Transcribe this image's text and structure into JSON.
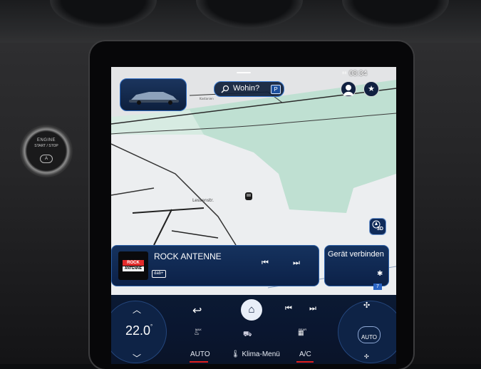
{
  "status": {
    "time": "08:34",
    "signal": "±±"
  },
  "search": {
    "label": "Wohin?",
    "parking_badge": "P"
  },
  "map": {
    "street_label": "Lessenstr.",
    "minor_label": "Kastanien",
    "view_3d_label": "3D"
  },
  "media": {
    "station_name": "ROCK ANTENNE",
    "logo_top": "ROCK",
    "logo_bottom": "ANTENNE",
    "dab_badge": "dab+",
    "prev_icon": "⏮",
    "next_icon": "⏭"
  },
  "connect": {
    "label": "Gerät verbinden",
    "bluetooth_icon": "✱",
    "badge": "7"
  },
  "climate": {
    "temperature": "22.0",
    "temp_unit": "°",
    "fan_mode": "AUTO",
    "auto_label": "AUTO",
    "klima_menu_label": "Klima-Menü",
    "ac_label": "A/C",
    "front_defrost_small": "MAX",
    "rear_defrost_small": "REAR"
  },
  "dashboard": {
    "engine_line1": "ENGINE",
    "engine_line2": "START / STOP",
    "eco": "A"
  },
  "colors": {
    "map_green": "#bfe0d2",
    "ui_blue": "#0c2148",
    "accent_red": "#e02020"
  }
}
